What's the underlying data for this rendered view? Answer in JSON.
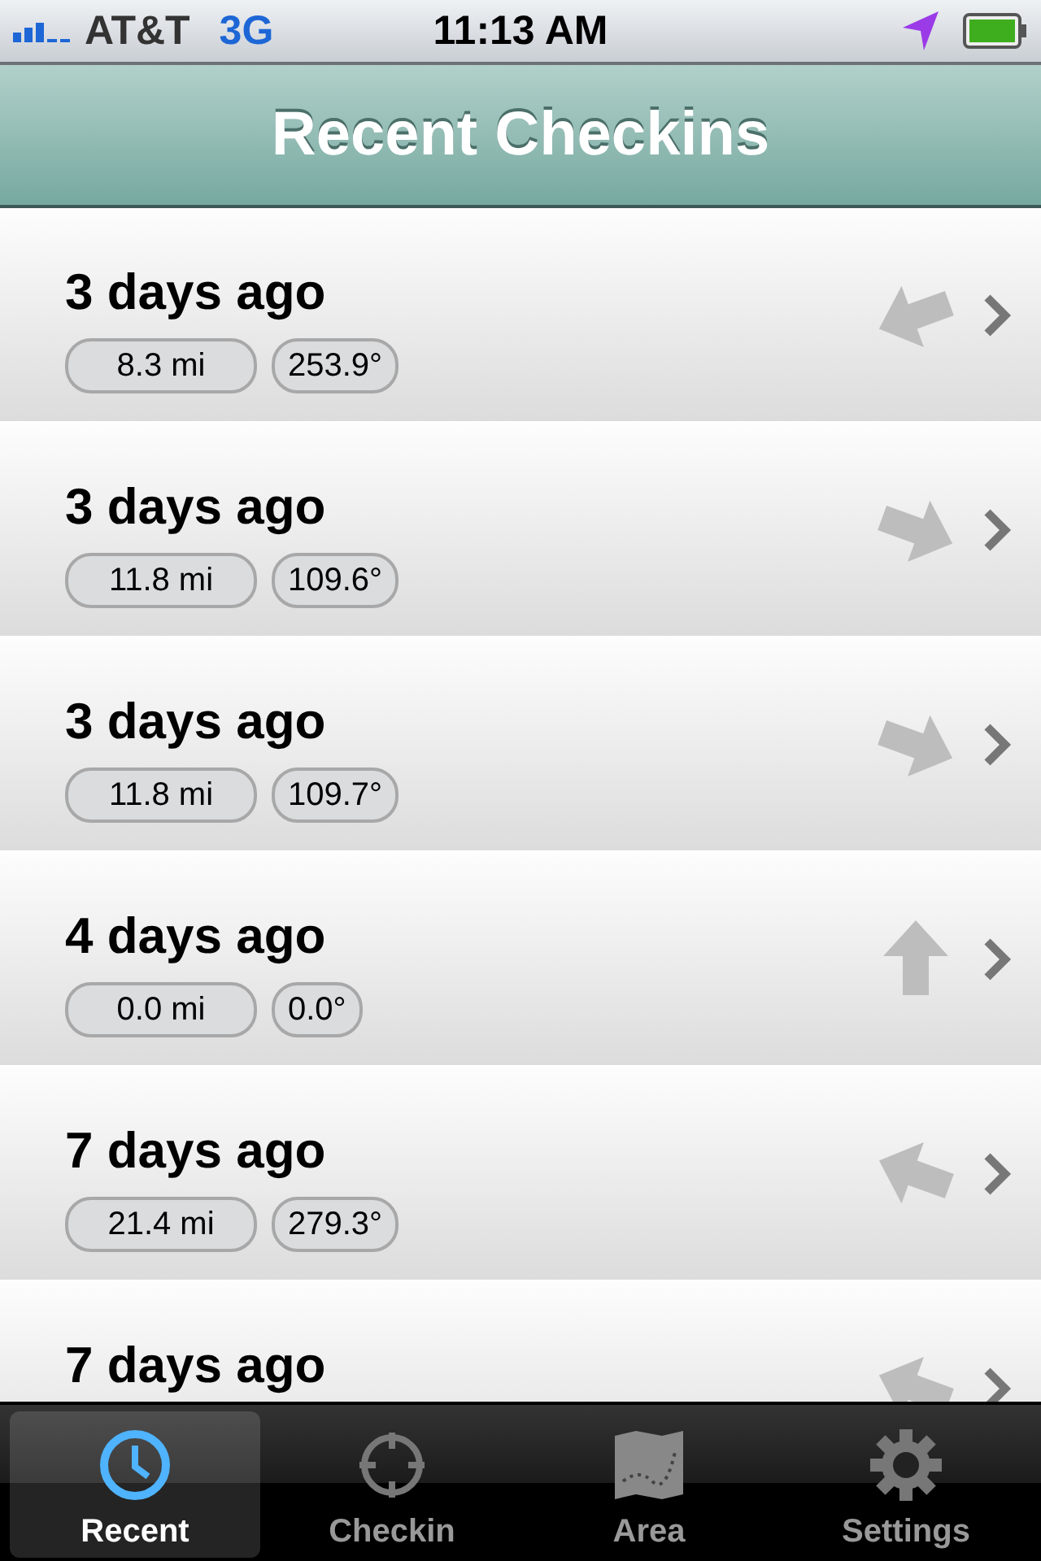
{
  "status_bar": {
    "carrier": "AT&T",
    "network": "3G",
    "time": "11:13 AM"
  },
  "nav_bar": {
    "title": "Recent Checkins"
  },
  "checkins": [
    {
      "when": "3 days ago",
      "distance": "8.3 mi",
      "bearing": "253.9°",
      "kind": "left-down"
    },
    {
      "when": "3 days ago",
      "distance": "11.8 mi",
      "bearing": "109.6°",
      "kind": "right-down"
    },
    {
      "when": "3 days ago",
      "distance": "11.8 mi",
      "bearing": "109.7°",
      "kind": "right-down"
    },
    {
      "when": "4 days ago",
      "distance": "0.0 mi",
      "bearing": "0.0°",
      "kind": "up"
    },
    {
      "when": "7 days ago",
      "distance": "21.4 mi",
      "bearing": "279.3°",
      "kind": "left-up"
    },
    {
      "when": "7 days ago",
      "kind": "left-up"
    }
  ],
  "tab_bar": [
    {
      "label": "Recent",
      "selected": true
    },
    {
      "label": "Checkin",
      "selected": false
    },
    {
      "label": "Area",
      "selected": false
    },
    {
      "label": "Settings",
      "selected": false
    }
  ]
}
